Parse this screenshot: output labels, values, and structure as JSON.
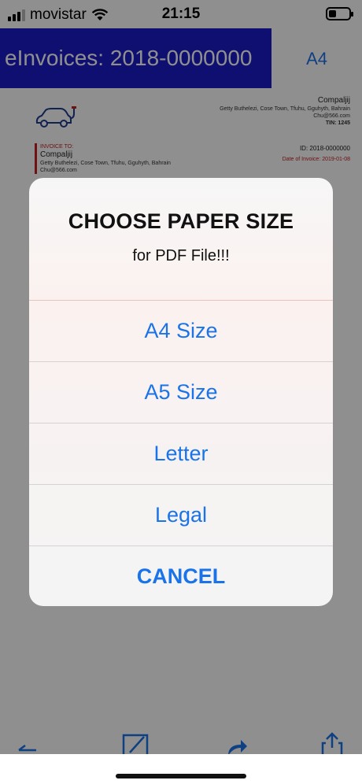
{
  "status_bar": {
    "carrier": "movistar",
    "time": "21:15"
  },
  "nav": {
    "title": "eInvoices: 2018-0000000",
    "right_label": "A4"
  },
  "invoice": {
    "company_name": "Compaljij",
    "company_address": "Getty Buthelezi, Cose Town, Tfuhu, Gguhyth, Bahrain",
    "company_email": "Chu@566.com",
    "company_tin": "TIN: 1245",
    "bill_label": "INVOICE TO:",
    "client_name": "Compaljij",
    "client_address": "Getty Buthelezi, Cose Town, Tfuhu, Gguhyth, Bahrain",
    "client_email": "Chu@566.com",
    "id_text": "ID: 2018-0000000",
    "date_text": "Date of Invoice: 2019-01-08"
  },
  "alert": {
    "title": "CHOOSE PAPER SIZE",
    "message": "for PDF File!!!",
    "options": [
      "A4 Size",
      "A5 Size",
      "Letter",
      "Legal"
    ],
    "cancel": "CANCEL"
  },
  "colors": {
    "accent": "#1a73e8",
    "nav_bg": "#1b1bcc",
    "invoice_red": "#c42121"
  }
}
